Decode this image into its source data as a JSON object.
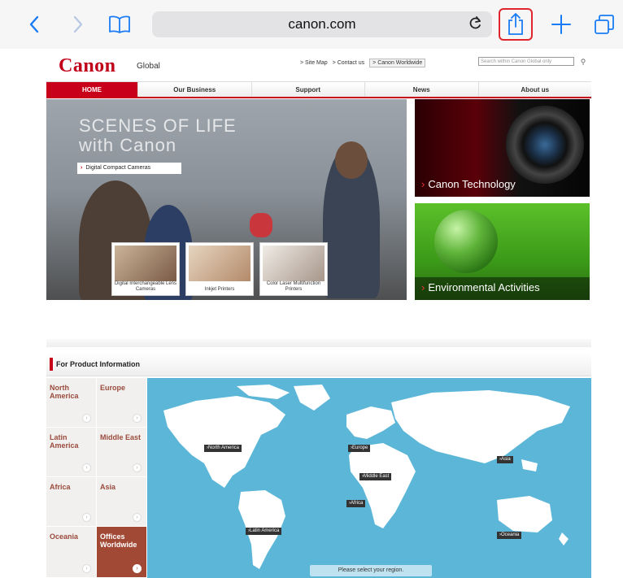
{
  "browser": {
    "url": "canon.com",
    "icons": {
      "back": "chevron-left-icon",
      "forward": "chevron-right-icon",
      "bookmarks": "book-icon",
      "reload": "reload-icon",
      "share": "share-icon",
      "new_tab": "plus-icon",
      "tabs": "tabs-icon"
    },
    "accent": "#1a7cf4",
    "highlight": "#e0262c"
  },
  "site": {
    "logo": "Canon",
    "region": "Global",
    "links": [
      "> Site Map",
      "> Contact us",
      "> Canon Worldwide"
    ],
    "search_placeholder": "Search within Canon Global only",
    "nav": [
      "HOME",
      "Our Business",
      "Support",
      "News",
      "About us"
    ],
    "brand_red": "#c8001a"
  },
  "hero": {
    "line1": "SCENES OF LIFE",
    "line2": "with Canon",
    "button": "Digital Compact Cameras",
    "thumbs": [
      {
        "caption": "Digital Interchangeable Lens Cameras"
      },
      {
        "caption": "Inkjet Printers"
      },
      {
        "caption": "Color Laser Multifunction Printers"
      }
    ]
  },
  "tiles": {
    "tech": "Canon Technology",
    "env": "Environmental Activities"
  },
  "product_info": {
    "title": "For Product Information",
    "regions": [
      {
        "label": "North America"
      },
      {
        "label": "Europe"
      },
      {
        "label": "Latin America"
      },
      {
        "label": "Middle East"
      },
      {
        "label": "Africa"
      },
      {
        "label": "Asia"
      },
      {
        "label": "Oceania"
      },
      {
        "label": "Offices Worldwide"
      }
    ],
    "map_pins": {
      "north_america": "North America",
      "europe": "Europe",
      "asia": "Asia",
      "middle_east": "Middle East",
      "africa": "Africa",
      "latin_america": "Latin America",
      "oceania": "Oceania"
    },
    "select_prompt": "Please select your region."
  }
}
